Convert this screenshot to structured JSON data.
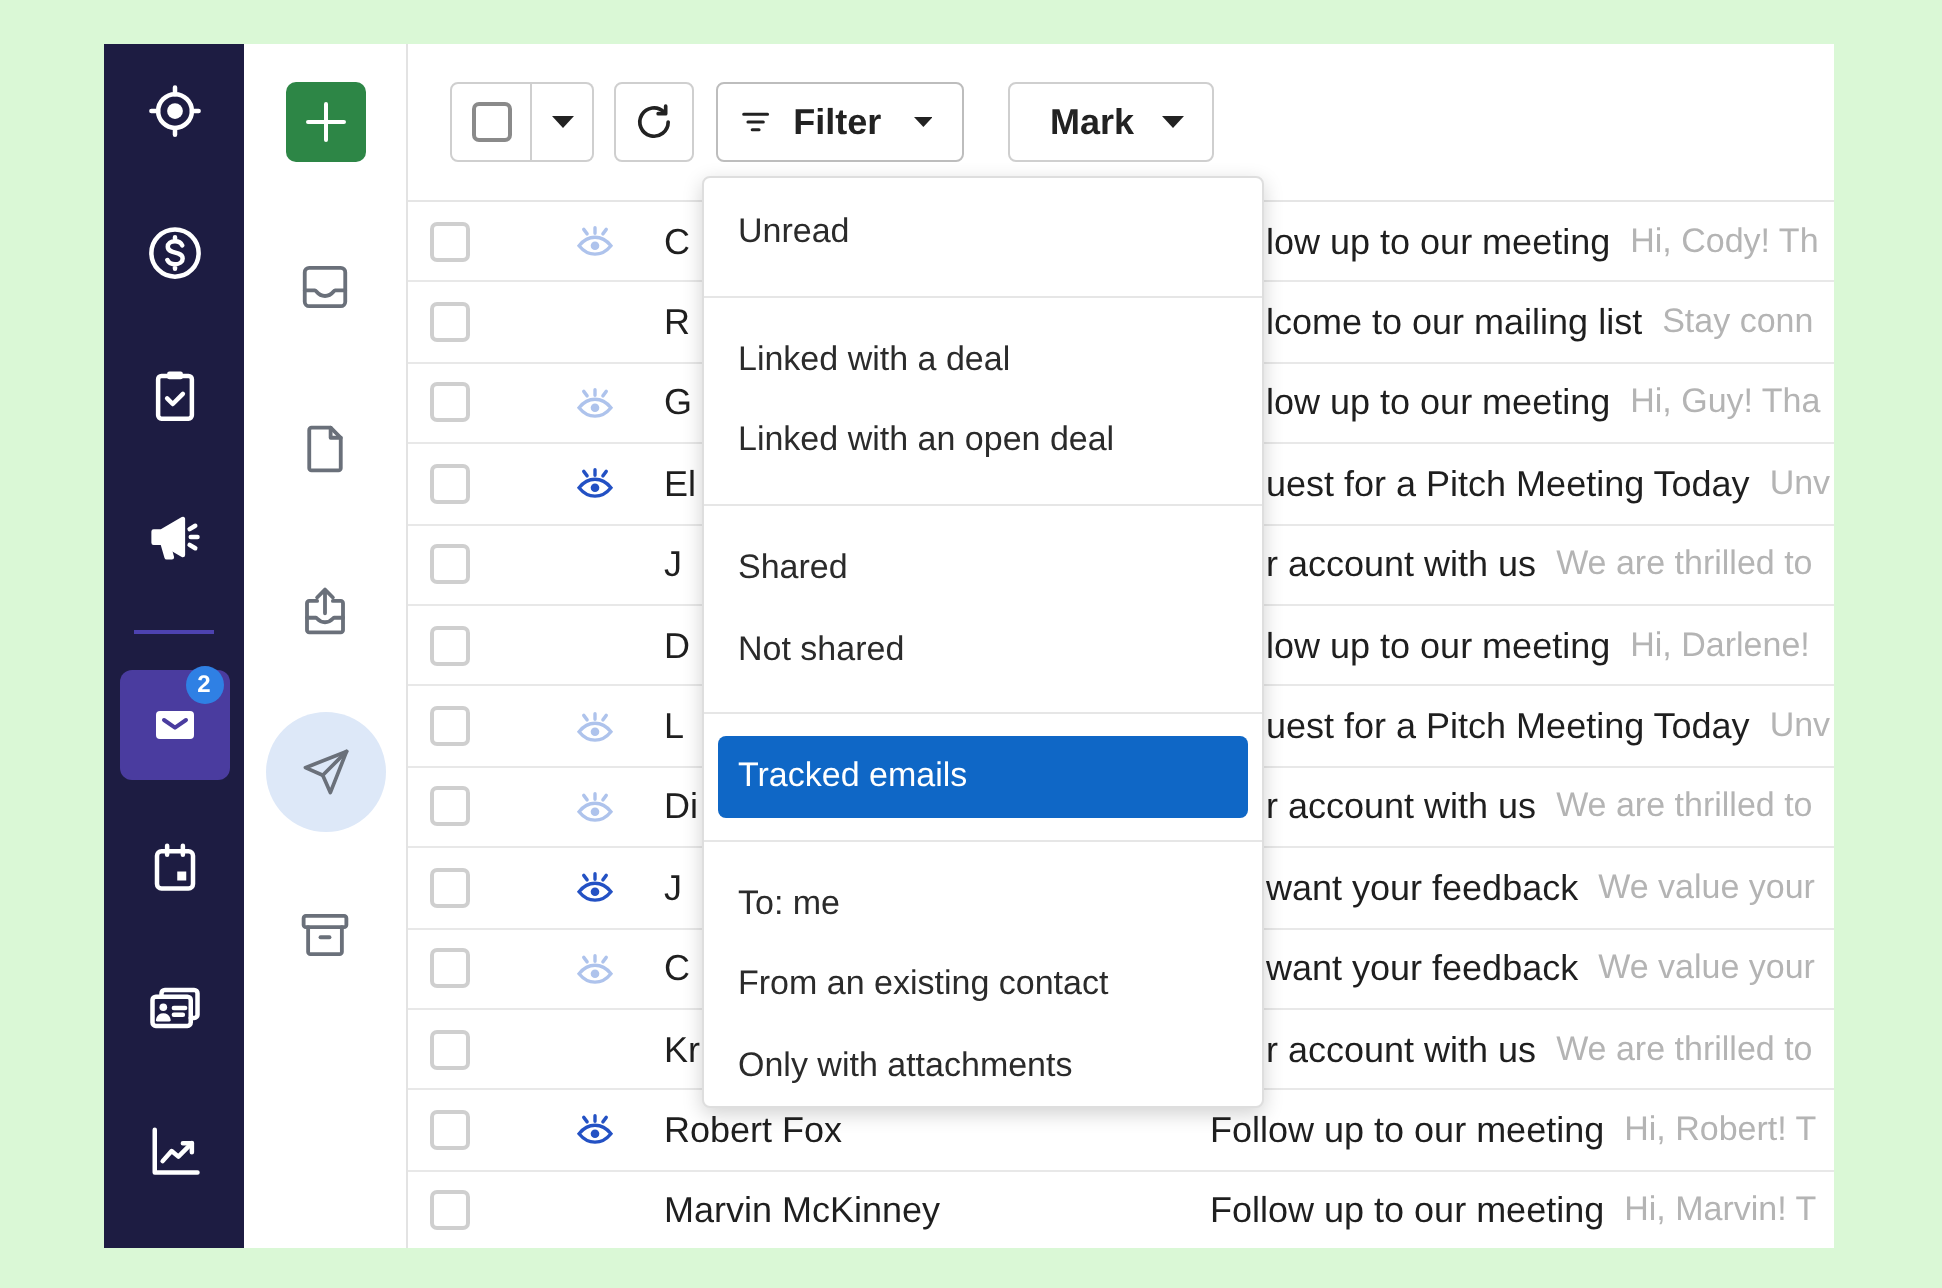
{
  "nav": {
    "groups": [
      {
        "items": [
          {
            "selected": false
          },
          {
            "selected": false
          },
          {
            "selected": false
          },
          {
            "selected": false
          }
        ]
      },
      {
        "items": [
          {
            "selected": true,
            "badge": "2"
          },
          {
            "selected": false
          },
          {
            "selected": false
          },
          {
            "selected": false
          }
        ]
      }
    ]
  },
  "folders": {
    "items": [
      {
        "selected": false
      },
      {
        "selected": false
      },
      {
        "selected": false
      },
      {
        "selected": true
      },
      {
        "selected": false
      }
    ]
  },
  "toolbar": {
    "select_all": {
      "checked": false
    },
    "filter": {
      "label": "Filter",
      "menu": {
        "groups": [
          {
            "items": [
              {
                "label": "Unread",
                "selected": false
              }
            ]
          },
          {
            "items": [
              {
                "label": "Linked with a deal",
                "selected": false
              },
              {
                "label": "Linked with an open deal",
                "selected": false
              }
            ]
          },
          {
            "items": [
              {
                "label": "Shared",
                "selected": false
              },
              {
                "label": "Not shared",
                "selected": false
              }
            ]
          },
          {
            "items": [
              {
                "label": "Tracked emails",
                "selected": true
              }
            ]
          },
          {
            "items": [
              {
                "label": "To: me",
                "selected": false
              },
              {
                "label": "From an existing contact",
                "selected": false
              },
              {
                "label": "Only with attachments",
                "selected": false
              }
            ]
          }
        ]
      }
    },
    "mark": {
      "label": "Mark"
    }
  },
  "rows": [
    {
      "checked": false,
      "eye": {
        "opened": false
      },
      "name": "C",
      "subject": "low up to our meeting",
      "preview": "Hi, Cody! Th"
    },
    {
      "checked": false,
      "name": "R",
      "subject": "lcome to our mailing list",
      "preview": "Stay conn"
    },
    {
      "checked": false,
      "eye": {
        "opened": false
      },
      "name": "G",
      "subject": "low up to our meeting",
      "preview": "Hi, Guy! Tha"
    },
    {
      "checked": false,
      "eye": {
        "opened": true
      },
      "name": "El",
      "subject": "uest for a Pitch Meeting Today",
      "preview": "Unv"
    },
    {
      "checked": false,
      "name": "J",
      "subject": "r account with us",
      "preview": "We are thrilled to"
    },
    {
      "checked": false,
      "name": "D",
      "subject": "low up to our meeting",
      "preview": "Hi, Darlene!"
    },
    {
      "checked": false,
      "eye": {
        "opened": false
      },
      "name": "L",
      "subject": "uest for a Pitch Meeting Today",
      "preview": "Unv"
    },
    {
      "checked": false,
      "eye": {
        "opened": false
      },
      "name": "Di",
      "subject": "r account with us",
      "preview": "We are thrilled to"
    },
    {
      "checked": false,
      "eye": {
        "opened": true
      },
      "name": "J",
      "subject": "want your feedback",
      "preview": "We value your"
    },
    {
      "checked": false,
      "eye": {
        "opened": false
      },
      "name": "C",
      "subject": "want your feedback",
      "preview": "We value your"
    },
    {
      "checked": false,
      "name": "Kr",
      "subject": "r account with us",
      "preview": "We are thrilled to"
    },
    {
      "checked": false,
      "eye": {
        "opened": true
      },
      "name": "Robert Fox",
      "subject": "Follow up to our meeting",
      "preview": "Hi, Robert! T"
    },
    {
      "checked": false,
      "name": "Marvin McKinney",
      "subject": "Follow up to our meeting",
      "preview": "Hi, Marvin! T"
    }
  ]
}
